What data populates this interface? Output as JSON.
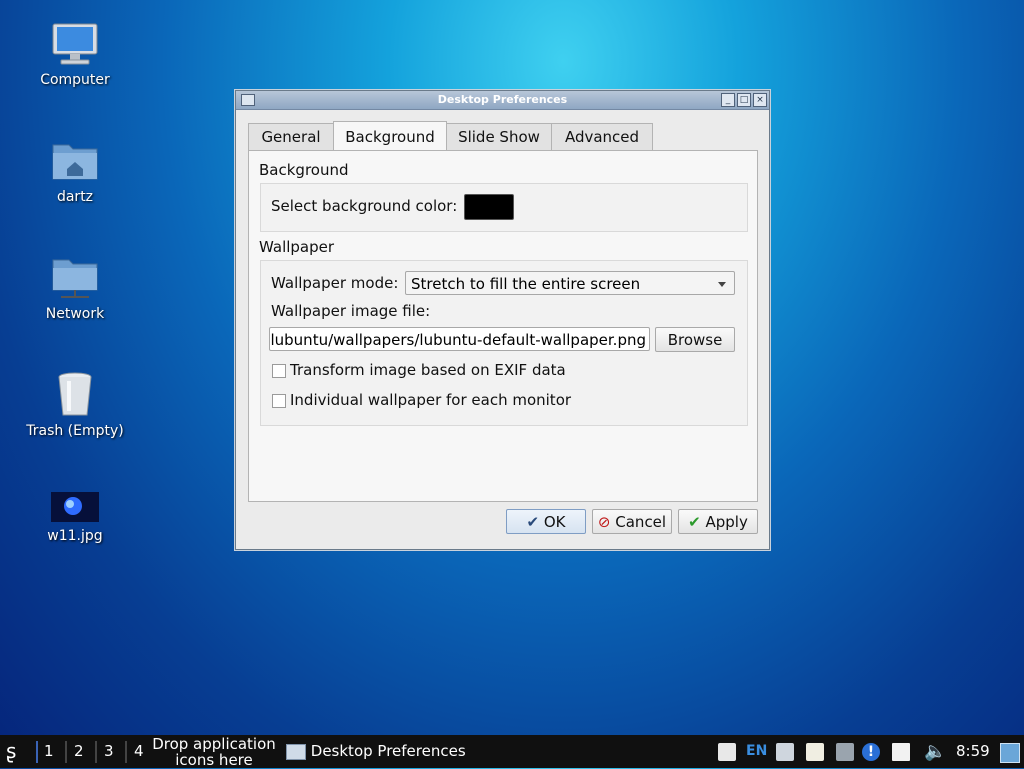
{
  "desktop": {
    "icons": [
      {
        "label": "Computer",
        "icon": "computer-icon"
      },
      {
        "label": "dartz",
        "icon": "home-folder-icon"
      },
      {
        "label": "Network",
        "icon": "network-folder-icon"
      },
      {
        "label": "Trash (Empty)",
        "icon": "trash-icon"
      },
      {
        "label": "w11.jpg",
        "icon": "image-file-icon"
      }
    ]
  },
  "window": {
    "title": "Desktop Preferences",
    "tabs": [
      {
        "label": "General",
        "active": false
      },
      {
        "label": "Background",
        "active": true
      },
      {
        "label": "Slide Show",
        "active": false
      },
      {
        "label": "Advanced",
        "active": false
      }
    ],
    "background_section": {
      "title": "Background",
      "color_label": "Select background color:",
      "color_value": "#000000"
    },
    "wallpaper_section": {
      "title": "Wallpaper",
      "mode_label": "Wallpaper mode:",
      "mode_value": "Stretch to fill the entire screen",
      "file_label": "Wallpaper image file:",
      "file_value": "lubuntu/wallpapers/lubuntu-default-wallpaper.png",
      "browse_label": "Browse",
      "exif_label": "Transform image based on EXIF data",
      "exif_checked": false,
      "individual_label": "Individual wallpaper for each monitor",
      "individual_checked": false
    },
    "buttons": {
      "ok": "OK",
      "cancel": "Cancel",
      "apply": "Apply"
    }
  },
  "taskbar": {
    "workspaces": [
      "1",
      "2",
      "3",
      "4"
    ],
    "launcher_hint_line1": "Drop application",
    "launcher_hint_line2": "icons here",
    "active_task": "Desktop Preferences",
    "keyboard_layout": "EN",
    "clock": "8:59",
    "accent_color": "#3a63b5"
  }
}
